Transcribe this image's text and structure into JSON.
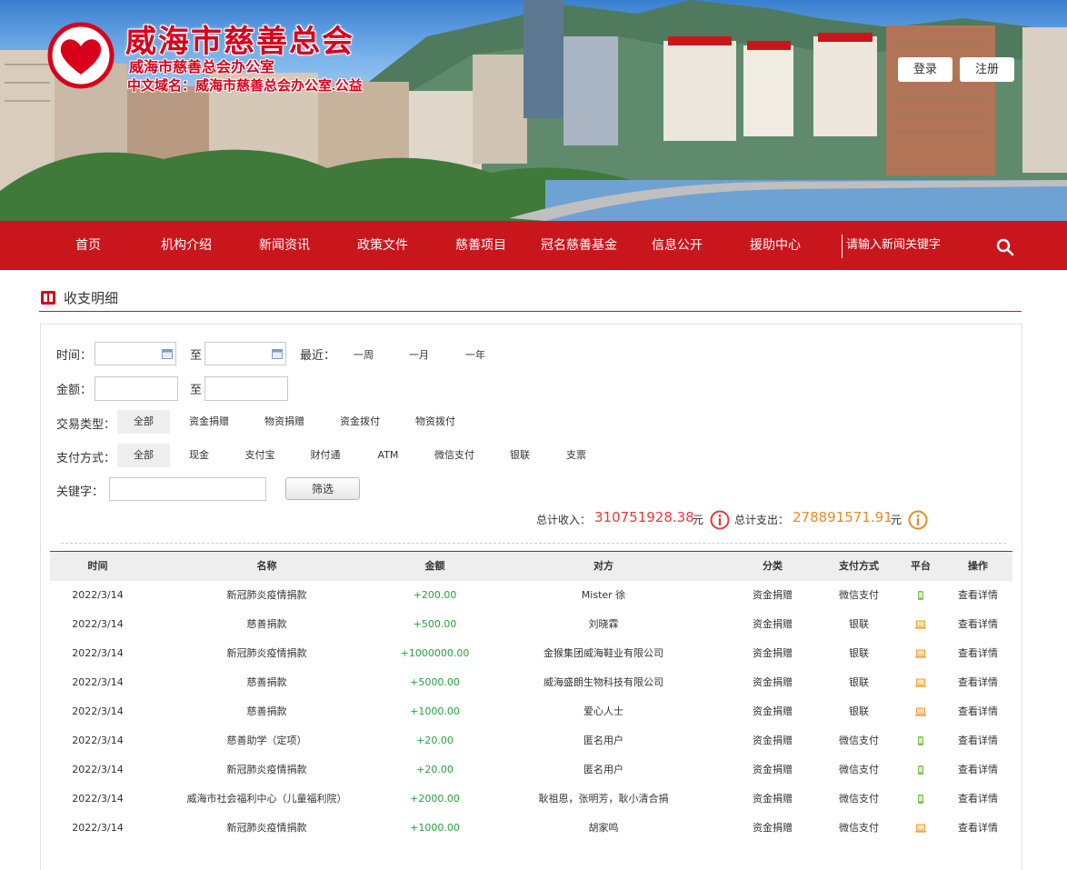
{
  "header": {
    "org_title": "威海市慈善总会",
    "org_sub1": "威海市慈善总会办公室",
    "org_sub2": "中文域名：威海市慈善总会办公室.公益",
    "login_label": "登录",
    "register_label": "注册"
  },
  "nav": {
    "items": [
      "首页",
      "机构介绍",
      "新闻资讯",
      "政策文件",
      "慈善项目",
      "冠名慈善基金",
      "信息公开",
      "援助中心"
    ],
    "search_placeholder": "请输入新闻关键字",
    "search_icon": "search-icon"
  },
  "section": {
    "title": "收支明细",
    "icon": "book-icon"
  },
  "filters": {
    "time_label": "时间：",
    "to_label": "至",
    "recent_label": "最近：",
    "recent_options": [
      "一周",
      "一月",
      "一年"
    ],
    "amount_label": "金额：",
    "type_label": "交易类型：",
    "type_options": [
      "全部",
      "资金捐赠",
      "物资捐赠",
      "资金拨付",
      "物资拨付"
    ],
    "type_selected": "全部",
    "pay_label": "支付方式：",
    "pay_options": [
      "全部",
      "现金",
      "支付宝",
      "财付通",
      "ATM",
      "微信支付",
      "银联",
      "支票"
    ],
    "pay_selected": "全部",
    "keyword_label": "关键字：",
    "keyword_value": "",
    "filter_button": "筛选"
  },
  "summary": {
    "income_label": "总计收入：",
    "income_value": "310751928.38",
    "income_unit": "元",
    "expense_label": "总计支出：",
    "expense_value": "278891571.91",
    "expense_unit": "元",
    "income_color": "#e8383d",
    "expense_color": "#e8892b"
  },
  "table": {
    "columns": [
      "时间",
      "名称",
      "金额",
      "对方",
      "分类",
      "支付方式",
      "平台",
      "操作"
    ],
    "rows": [
      {
        "time": "2022/3/14",
        "name": "新冠肺炎疫情捐款",
        "amount": "+200.00",
        "party": "Mister 徐",
        "category": "资金捐赠",
        "pay": "微信支付",
        "platform": "mobile",
        "action": "查看详情"
      },
      {
        "time": "2022/3/14",
        "name": "慈善捐款",
        "amount": "+500.00",
        "party": "刘晓霖",
        "category": "资金捐赠",
        "pay": "银联",
        "platform": "pc",
        "action": "查看详情"
      },
      {
        "time": "2022/3/14",
        "name": "新冠肺炎疫情捐款",
        "amount": "+1000000.00",
        "party": "金猴集团威海鞋业有限公司",
        "category": "资金捐赠",
        "pay": "银联",
        "platform": "pc",
        "action": "查看详情"
      },
      {
        "time": "2022/3/14",
        "name": "慈善捐款",
        "amount": "+5000.00",
        "party": "威海盛朗生物科技有限公司",
        "category": "资金捐赠",
        "pay": "银联",
        "platform": "pc",
        "action": "查看详情"
      },
      {
        "time": "2022/3/14",
        "name": "慈善捐款",
        "amount": "+1000.00",
        "party": "爱心人士",
        "category": "资金捐赠",
        "pay": "银联",
        "platform": "pc",
        "action": "查看详情"
      },
      {
        "time": "2022/3/14",
        "name": "慈善助学（定项）",
        "amount": "+20.00",
        "party": "匿名用户",
        "category": "资金捐赠",
        "pay": "微信支付",
        "platform": "mobile",
        "action": "查看详情"
      },
      {
        "time": "2022/3/14",
        "name": "新冠肺炎疫情捐款",
        "amount": "+20.00",
        "party": "匿名用户",
        "category": "资金捐赠",
        "pay": "微信支付",
        "platform": "mobile",
        "action": "查看详情"
      },
      {
        "time": "2022/3/14",
        "name": "威海市社会福利中心（儿童福利院）",
        "amount": "+2000.00",
        "party": "耿祖恩，张明芳，耿小清合捐",
        "category": "资金捐赠",
        "pay": "微信支付",
        "platform": "mobile",
        "action": "查看详情"
      },
      {
        "time": "2022/3/14",
        "name": "新冠肺炎疫情捐款",
        "amount": "+1000.00",
        "party": "胡家鸣",
        "category": "资金捐赠",
        "pay": "微信支付",
        "platform": "pc",
        "action": "查看详情"
      }
    ]
  }
}
